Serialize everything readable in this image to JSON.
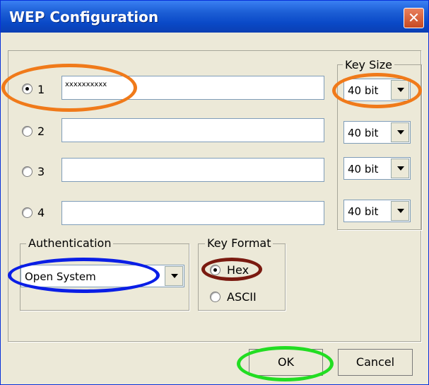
{
  "dialog": {
    "title": "WEP Configuration"
  },
  "keys": [
    {
      "label": "1",
      "selected": true,
      "value": "xxxxxxxxxx",
      "size": "40 bit"
    },
    {
      "label": "2",
      "selected": false,
      "value": "",
      "size": "40 bit"
    },
    {
      "label": "3",
      "selected": false,
      "value": "",
      "size": "40 bit"
    },
    {
      "label": "4",
      "selected": false,
      "value": "",
      "size": "40 bit"
    }
  ],
  "key_size_group": {
    "title": "Key Size"
  },
  "authentication": {
    "title": "Authentication",
    "value": "Open System"
  },
  "key_format": {
    "title": "Key Format",
    "hex": "Hex",
    "ascii": "ASCII",
    "selected": "Hex"
  },
  "buttons": {
    "ok": "OK",
    "cancel": "Cancel"
  },
  "highlight_colors": {
    "orange": "#f07a1a",
    "blue": "#0a1ee6",
    "dark_red": "#7a1a10",
    "green": "#22dd22"
  }
}
